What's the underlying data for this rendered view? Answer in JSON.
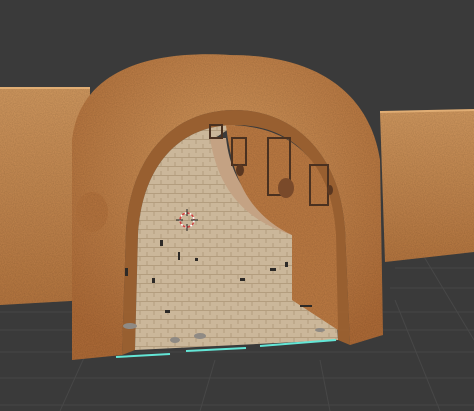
{
  "viewport": {
    "background": "#3a3a3a",
    "grid_color": "#4a4a4a",
    "grid_dark": "#2f2f2f"
  },
  "scene": {
    "wall_color": "#c98a4e",
    "wall_shadow": "#9c6233",
    "wall_highlight": "#dba268",
    "arch_color": "#c57f43",
    "arch_inner": "#a86532",
    "floor_color": "#cbb79a",
    "floor_lines": "#b7a284",
    "rock_color": "#8f8a84",
    "debris_color": "#2d2a27",
    "edge_highlight": "#63e6d6"
  },
  "gizmo": {
    "name": "3d-cursor-icon"
  }
}
